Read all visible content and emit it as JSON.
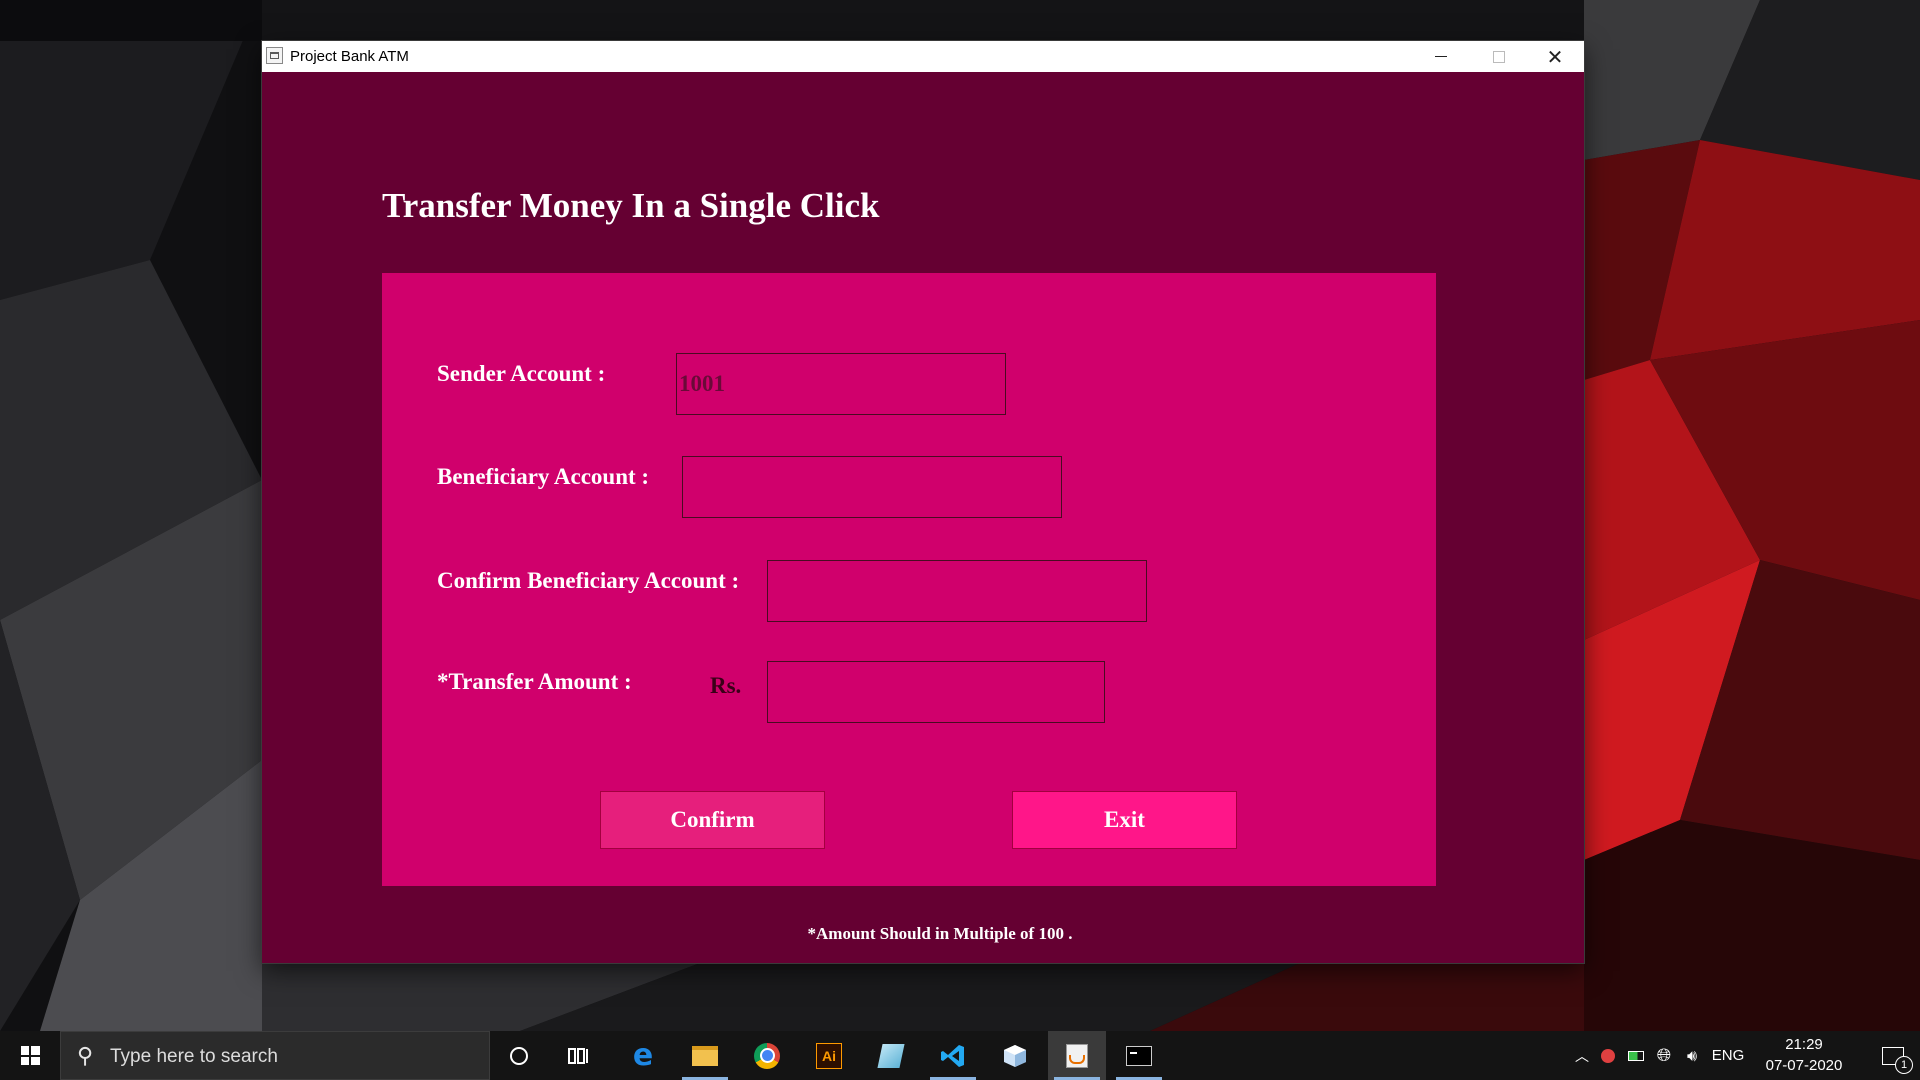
{
  "window": {
    "title": "Project Bank ATM",
    "close_symbol": "✕"
  },
  "heading": "Transfer Money In a Single Click",
  "form": {
    "sender_label": "Sender Account :",
    "sender_value": "1001",
    "beneficiary_label": "Beneficiary Account :",
    "beneficiary_value": "",
    "confirm_beneficiary_label": "Confirm Beneficiary Account :",
    "confirm_beneficiary_value": "",
    "amount_label": "*Transfer Amount :",
    "currency": "Rs.",
    "amount_value": ""
  },
  "buttons": {
    "confirm": "Confirm",
    "exit": "Exit"
  },
  "note": "*Amount Should  in Multiple of 100 .",
  "taskbar": {
    "search_placeholder": "Type here to search",
    "pinned": [
      "cortana-icon",
      "task-view-icon",
      "edge-icon",
      "file-explorer-icon",
      "chrome-icon",
      "illustrator-icon",
      "notepad-icon",
      "vscode-icon",
      "box-app-icon",
      "java-icon",
      "terminal-icon"
    ],
    "illustrator_text": "Ai",
    "language": "ENG",
    "time": "21:29",
    "date": "07-07-2020",
    "notification_count": "1"
  },
  "colors": {
    "window_bg": "#650032",
    "panel_bg": "#d0006c",
    "confirm_btn": "#e61f7c",
    "exit_btn": "#ff1689"
  }
}
